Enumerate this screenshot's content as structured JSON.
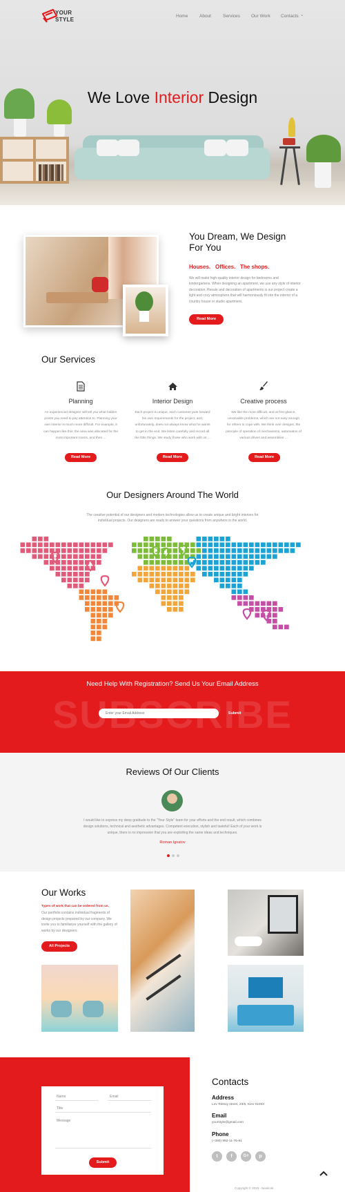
{
  "header": {
    "logo_text": "YOUR STYLE",
    "nav": [
      "Home",
      "About",
      "Services",
      "Our Work",
      "Contacts"
    ],
    "contacts_chevron": "⌄"
  },
  "hero": {
    "title_part1": "We Love ",
    "title_accent": "Interior",
    "title_part2": " Design"
  },
  "dream": {
    "title": "You Dream, We Design For You",
    "tags": [
      "Houses.",
      "Offices.",
      "The shops."
    ],
    "text": "We will make high-quality interior design for bedrooms and kindergartens. When designing an apartment, we use any style of interior decoration. Resale and decoration of apartments is our project create a light and cozy atmosphere that will harmoniously fit into the interior of a country house or studio apartment.",
    "button": "Read More"
  },
  "services": {
    "title": "Our Services",
    "items": [
      {
        "icon": "document-icon",
        "title": "Planning",
        "text": "An experienced designer will tell you what hidden points you need to pay attention to. Planning your own interior is much more difficult. For example, it can happen like this: the area was allocated for the most important rooms, and then ...",
        "button": "Read More"
      },
      {
        "icon": "home-icon",
        "title": "Interior Design",
        "text": "Each project is unique, each customer puts forward his own requirements for the project, and, unfortunately, does not always know what he wants to get in the end. We listen carefully and record all the little things. We study those who work with us ...",
        "button": "Read More"
      },
      {
        "icon": "paintbrush-icon",
        "title": "Creative process",
        "text": "We like the most difficult, and at first glance, unsolvable problems, which are not easy enough for others to cope with. We think over designs, the principle of operation of mechanisms, automation of various drives and assemblies ...",
        "button": "Read More"
      }
    ]
  },
  "designers": {
    "title": "Our Designers Around The World",
    "text": "The creative potential of our designers and modern technologies allow us to create unique and bright interiors for individual projects. Our designers are ready to answer your questions from anywhere in the world.",
    "colors": {
      "north_america": "#e05a7a",
      "south_america": "#f0873a",
      "europe": "#7cbc3a",
      "africa": "#f2a53a",
      "asia": "#1aa3d4",
      "oceania": "#c64fa6"
    }
  },
  "subscribe": {
    "heading": "Need Help With Registration? Send Us Your Email Address",
    "bg_word": "SUBSCRIBE",
    "placeholder": "Enter your Email Address",
    "button": "Submit"
  },
  "reviews": {
    "title": "Reviews Of Our Clients",
    "text": "I would like to express my deep gratitude to the \"Your Style\" team for your efforts and the end result, which combines design solutions, technical and aesthetic advantages. Competent execution, stylish and tasteful! Each of your work is unique, there is no impression that you are exploiting the same ideas and techniques.",
    "author": "Roman Ignatov",
    "dots": 3
  },
  "works": {
    "title": "Our Works",
    "subtitle": "Types of work that can be ordered from us.",
    "text": "Our portfolio contains individual fragments of design projects prepared by our company. We invite you to familiarize yourself with the gallery of works by our designers.",
    "button": "All Projects"
  },
  "contact_form": {
    "name": "Name",
    "email": "Email",
    "title": "Title",
    "message": "Message",
    "button": "Submit"
  },
  "contacts": {
    "title": "Contacts",
    "address_label": "Address",
    "address": "Lev Tolstoy street, 23/5, Kiev 01003",
    "email_label": "Email",
    "email": "yourstyle@gmail.com",
    "phone_label": "Phone",
    "phone": "(+380) 992-11-75-91",
    "social": [
      "twitter-icon",
      "facebook-icon",
      "google-plus-icon",
      "pinterest-icon"
    ]
  },
  "footer": {
    "copyright": "Copyright © 2020 - Neolicek",
    "scroll_top": "^"
  }
}
